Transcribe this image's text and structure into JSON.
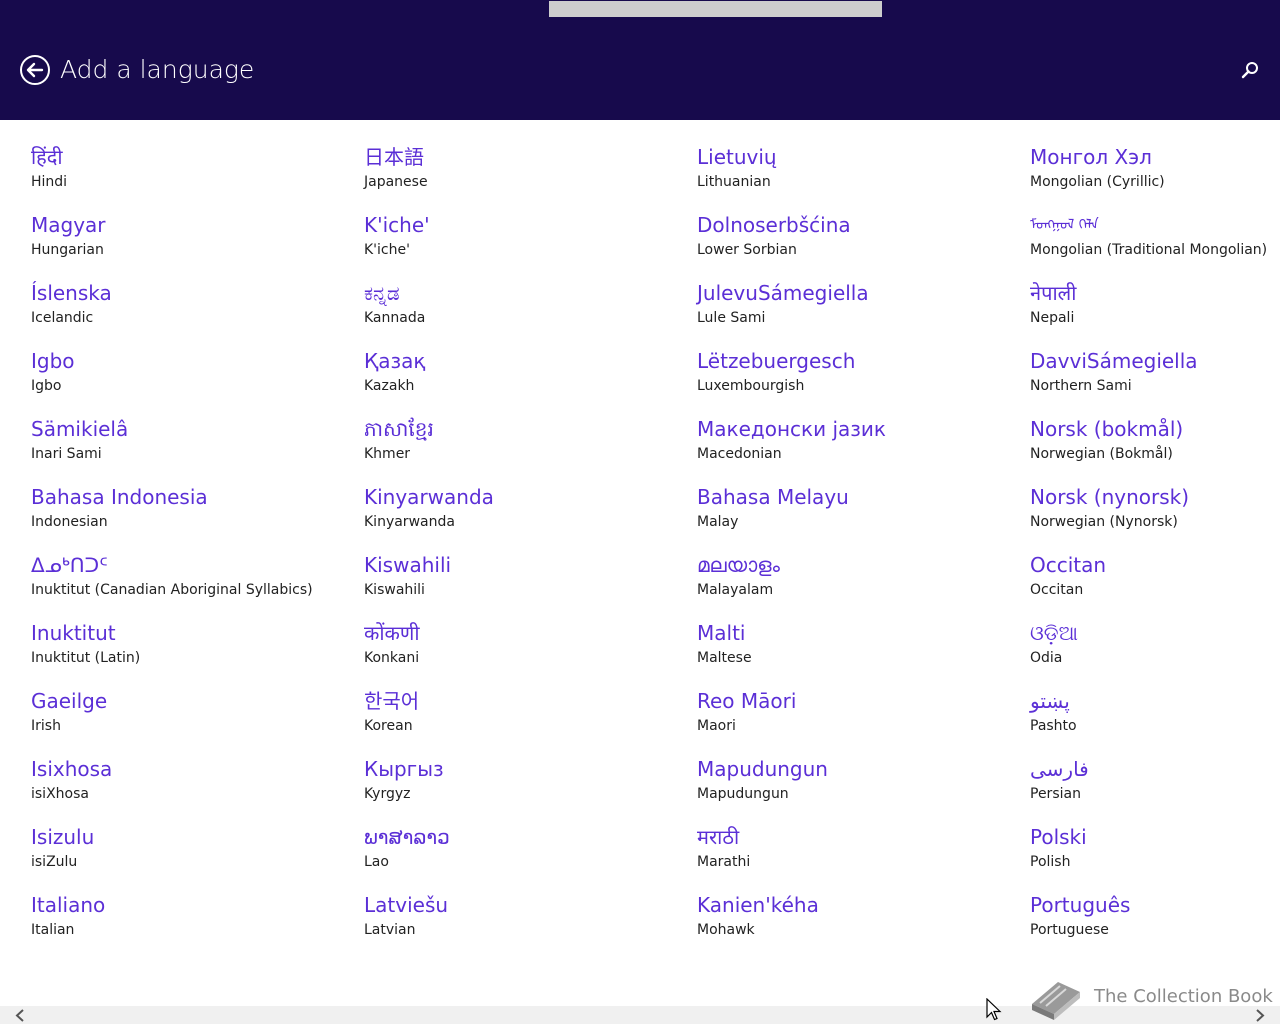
{
  "header": {
    "title": "Add a language",
    "back_icon": "back-arrow-icon",
    "search_icon": "search-icon"
  },
  "colors": {
    "header_bg": "#170a4c",
    "accent": "#5b2fd6",
    "secondary_text": "#222222"
  },
  "columns": [
    {
      "items": [
        {
          "native": "हिंदी",
          "english": "Hindi"
        },
        {
          "native": "Magyar",
          "english": "Hungarian"
        },
        {
          "native": "Íslenska",
          "english": "Icelandic"
        },
        {
          "native": "Igbo",
          "english": "Igbo"
        },
        {
          "native": "Sämikielâ",
          "english": "Inari Sami"
        },
        {
          "native": "Bahasa Indonesia",
          "english": "Indonesian"
        },
        {
          "native": "ᐃᓄᒃᑎᑐᑦ",
          "english": "Inuktitut (Canadian Aboriginal Syllabics)"
        },
        {
          "native": "Inuktitut",
          "english": "Inuktitut (Latin)"
        },
        {
          "native": "Gaeilge",
          "english": "Irish"
        },
        {
          "native": "Isixhosa",
          "english": "isiXhosa"
        },
        {
          "native": "Isizulu",
          "english": "isiZulu"
        },
        {
          "native": "Italiano",
          "english": "Italian"
        }
      ]
    },
    {
      "items": [
        {
          "native": "日本語",
          "english": "Japanese"
        },
        {
          "native": "K'iche'",
          "english": "K'iche'"
        },
        {
          "native": "ಕನ್ನಡ",
          "english": "Kannada"
        },
        {
          "native": "Қазақ",
          "english": "Kazakh"
        },
        {
          "native": "ភាសាខ្មែរ",
          "english": "Khmer"
        },
        {
          "native": "Kinyarwanda",
          "english": "Kinyarwanda"
        },
        {
          "native": "Kiswahili",
          "english": "Kiswahili"
        },
        {
          "native": "कोंकणी",
          "english": "Konkani"
        },
        {
          "native": "한국어",
          "english": "Korean"
        },
        {
          "native": "Кыргыз",
          "english": "Kyrgyz"
        },
        {
          "native": "ພາສາລາວ",
          "english": "Lao"
        },
        {
          "native": "Latviešu",
          "english": "Latvian"
        }
      ]
    },
    {
      "items": [
        {
          "native": "Lietuvių",
          "english": "Lithuanian"
        },
        {
          "native": "Dolnoserbšćina",
          "english": "Lower Sorbian"
        },
        {
          "native": "JulevuSámegiella",
          "english": "Lule Sami"
        },
        {
          "native": "Lëtzebuergesch",
          "english": "Luxembourgish"
        },
        {
          "native": "Македонски јазик",
          "english": "Macedonian"
        },
        {
          "native": "Bahasa Melayu",
          "english": "Malay"
        },
        {
          "native": "മലയാളം",
          "english": "Malayalam"
        },
        {
          "native": "Malti",
          "english": "Maltese"
        },
        {
          "native": "Reo Māori",
          "english": "Maori"
        },
        {
          "native": "Mapudungun",
          "english": "Mapudungun"
        },
        {
          "native": "मराठी",
          "english": "Marathi"
        },
        {
          "native": "Kanien'kéha",
          "english": "Mohawk"
        }
      ]
    },
    {
      "items": [
        {
          "native": "Монгол Хэл",
          "english": "Mongolian (Cyrillic)"
        },
        {
          "native": "ᠮᠣᠩᠭᠣᠯ ᠬᠡᠯᠡ",
          "english": "Mongolian (Traditional Mongolian)"
        },
        {
          "native": "नेपाली",
          "english": "Nepali"
        },
        {
          "native": "DavviSámegiella",
          "english": "Northern Sami"
        },
        {
          "native": "Norsk (bokmål)",
          "english": "Norwegian (Bokmål)"
        },
        {
          "native": "Norsk (nynorsk)",
          "english": "Norwegian (Nynorsk)"
        },
        {
          "native": "Occitan",
          "english": "Occitan"
        },
        {
          "native": "ଓଡ଼ିଆ",
          "english": "Odia"
        },
        {
          "native": "پښتو",
          "english": "Pashto"
        },
        {
          "native": "فارسى",
          "english": "Persian"
        },
        {
          "native": "Polski",
          "english": "Polish"
        },
        {
          "native": "Português",
          "english": "Portuguese"
        }
      ]
    }
  ],
  "scrollbar": {
    "left_icon": "chevron-left-icon",
    "right_icon": "chevron-right-icon"
  },
  "watermark": {
    "text": "The Collection Book",
    "icon": "book-icon"
  }
}
